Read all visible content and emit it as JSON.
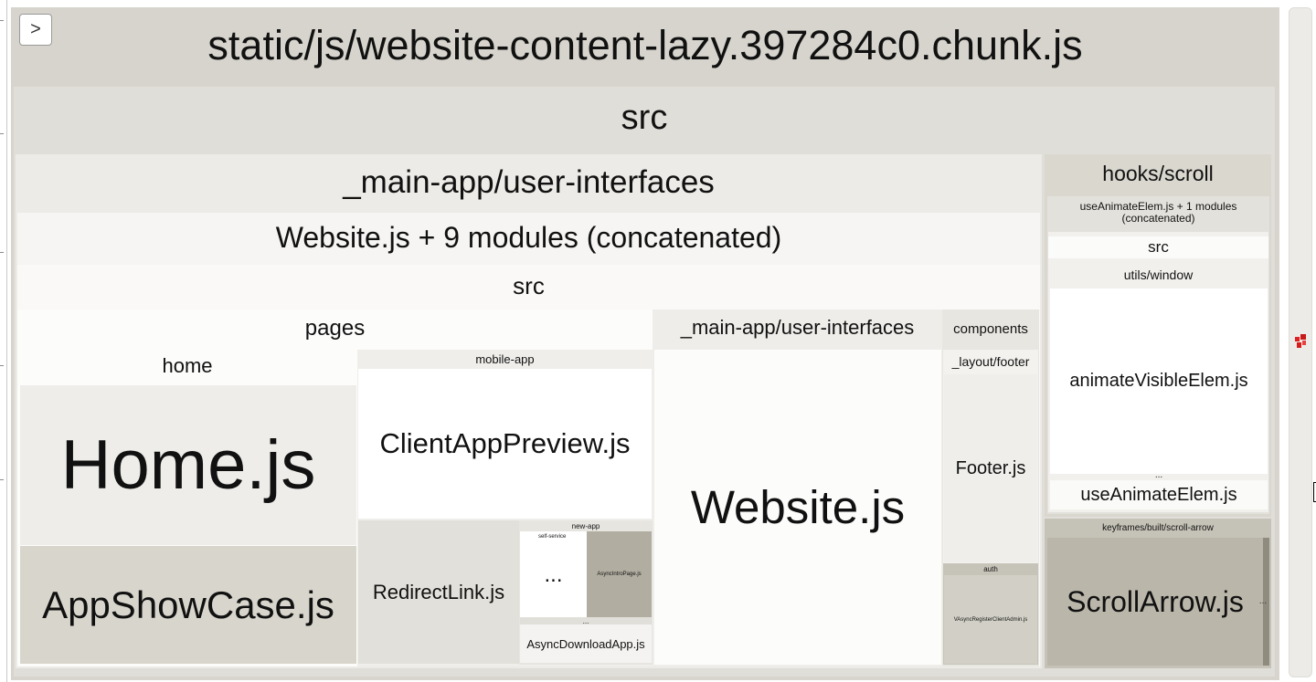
{
  "toggle": {
    "glyph": ">"
  },
  "chunk": {
    "title": "static/js/website-content-lazy.397284c0.chunk.js",
    "src": "src",
    "main_app": {
      "label": "_main-app/user-interfaces",
      "website_concat": "Website.js + 9 modules (concatenated)",
      "src": "src",
      "pages": {
        "label": "pages",
        "home": {
          "label": "home",
          "home_js": "Home.js",
          "app_showcase_js": "AppShowCase.js"
        },
        "mobile_app": {
          "label": "mobile-app",
          "client_app_preview_js": "ClientAppPreview.js",
          "redirect_link_js": "RedirectLink.js",
          "new_app": {
            "label": "new-app",
            "self_service": "self-service",
            "ellipsis": "...",
            "async_intro_page_js": "AsyncIntroPage.js",
            "small_ellipsis": "...",
            "async_download_app_js": "AsyncDownloadApp.js"
          }
        }
      },
      "inner_main_app": {
        "label": "_main-app/user-interfaces",
        "website_js": "Website.js"
      },
      "components": {
        "label": "components",
        "layout_footer": "_layout/footer",
        "footer_js": "Footer.js",
        "auth": "auth",
        "async_register_js": "VAsyncRegisterClientAdmin.js"
      }
    },
    "hooks": {
      "label": "hooks/scroll",
      "use_animate_concat": "useAnimateElem.js + 1 modules (concatenated)",
      "src": "src",
      "utils_window": "utils/window",
      "animate_visible_js": "animateVisibleElem.js",
      "ellipsis": "...",
      "use_animate_js": "useAnimateElem.js"
    },
    "keyframes": {
      "label": "keyframes/built/scroll-arrow",
      "scroll_arrow_js": "ScrollArrow.js",
      "ellipsis": "..."
    }
  },
  "colors": {
    "chunk_bg": "#d6d4cc",
    "src_bg": "#e0ded8",
    "main_app_bg": "#ecebe7",
    "website_bg": "#f6f5f3",
    "src2_bg": "#faf9f8",
    "pages_bg": "#fcfcfb",
    "home_js": "#eeedea",
    "app_showcase": "#d8d6cc",
    "client_app": "#ffffff",
    "redirect": "#e2e0da",
    "intro_page": "#b1ada0",
    "website_js": "#fcfcfb",
    "footer": "#efeeea",
    "auth": "#d2d0c6",
    "hooks_bg": "#d9d7ce",
    "scroll_arrow": "#bab6aa",
    "minimap_marker": "#e02020"
  }
}
